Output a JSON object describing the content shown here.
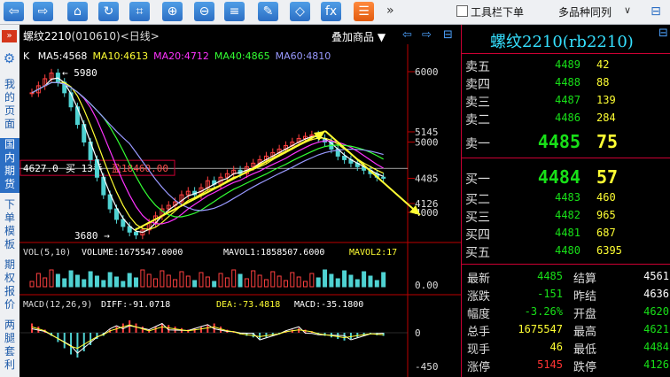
{
  "toolbar": {
    "buttons": [
      {
        "name": "back-button",
        "glyph": "⇦"
      },
      {
        "name": "forward-button",
        "glyph": "⇨"
      },
      {
        "name": "home-button",
        "glyph": "⌂"
      },
      {
        "name": "refresh-button",
        "glyph": "↻"
      },
      {
        "name": "crop-button",
        "glyph": "⌗"
      },
      {
        "name": "zoom-in-button",
        "glyph": "⊕"
      },
      {
        "name": "zoom-out-button",
        "glyph": "⊖"
      },
      {
        "name": "indicator-button",
        "glyph": "≡"
      },
      {
        "name": "draw-button",
        "glyph": "✎"
      },
      {
        "name": "mark-button",
        "glyph": "◇"
      },
      {
        "name": "fx-button",
        "glyph": "fx"
      },
      {
        "name": "list-button",
        "glyph": "☰"
      }
    ],
    "more_glyph": "»",
    "order_label": "工具栏下单",
    "select_value": "多品种同列",
    "select_arrow": "∨",
    "layout_glyph": "⊟"
  },
  "sidebar": {
    "collapse_glyph": "»",
    "gear_glyph": "⚙",
    "items": [
      {
        "label": "我的页面",
        "active": false
      },
      {
        "label": "国内期货",
        "active": true
      },
      {
        "label": "下单模板",
        "active": false
      },
      {
        "label": "期权报价",
        "active": false
      },
      {
        "label": "两腿套利",
        "active": false
      }
    ]
  },
  "chart_header": {
    "symbol": "螺纹2210",
    "code": "(010610)",
    "period": "<日线>",
    "overlay": "叠加商品",
    "overlay_arrow": "▼",
    "icon_prev": "⇦",
    "icon_next": "⇨",
    "icon_layout": "⊟"
  },
  "ma": {
    "k": "K",
    "items": [
      {
        "label": "MA5:4568",
        "color": "#ffffff"
      },
      {
        "label": "MA10:4613",
        "color": "#ffff33"
      },
      {
        "label": "MA20:4712",
        "color": "#ff33ff"
      },
      {
        "label": "MA40:4865",
        "color": "#33ff33"
      },
      {
        "label": "MA60:4810",
        "color": "#9999ff"
      }
    ]
  },
  "chart_data": [
    {
      "type": "candlestick",
      "panel": "price",
      "y_ticks": [
        6000,
        5145,
        5000,
        4485,
        4126,
        4000
      ],
      "annotations": {
        "high": "5980",
        "low": "3680",
        "crosshair_price": "4627.0",
        "position_label": "买 13手",
        "profit_label": "盈18460.00"
      },
      "ma_values": {
        "MA5": 4568,
        "MA10": 4613,
        "MA20": 4712,
        "MA40": 4865,
        "MA60": 4810
      }
    },
    {
      "type": "bar",
      "panel": "volume",
      "label": "VOL(5,10)",
      "volume": "VOLUME:1675547.0000",
      "mavol1": "MAVOL1:1858507.6000",
      "mavol2": "MAVOL2:17",
      "y_ticks": [
        "0.00"
      ]
    },
    {
      "type": "bar",
      "panel": "macd",
      "label": "MACD(12,26,9)",
      "diff": "DIFF:-91.0718",
      "dea": "DEA:-73.4818",
      "macd": "MACD:-35.1800",
      "y_ticks": [
        "0",
        "-450"
      ]
    }
  ],
  "quote": {
    "title": "螺纹2210(rb2210)",
    "title_icon": "⊟",
    "asks": [
      {
        "label": "卖五",
        "price": "4489",
        "vol": "42"
      },
      {
        "label": "卖四",
        "price": "4488",
        "vol": "88"
      },
      {
        "label": "卖三",
        "price": "4487",
        "vol": "139"
      },
      {
        "label": "卖二",
        "price": "4486",
        "vol": "284"
      },
      {
        "label": "卖一",
        "price": "4485",
        "vol": "75"
      }
    ],
    "bids": [
      {
        "label": "买一",
        "price": "4484",
        "vol": "57"
      },
      {
        "label": "买二",
        "price": "4483",
        "vol": "460"
      },
      {
        "label": "买三",
        "price": "4482",
        "vol": "965"
      },
      {
        "label": "买四",
        "price": "4481",
        "vol": "687"
      },
      {
        "label": "买五",
        "price": "4480",
        "vol": "6395"
      }
    ],
    "stats": [
      {
        "l1": "最新",
        "v1": "4485",
        "c1": "#18e018",
        "l2": "结算",
        "v2": "4561",
        "c2": "#ffffff"
      },
      {
        "l1": "涨跌",
        "v1": "-151",
        "c1": "#18e018",
        "l2": "昨结",
        "v2": "4636",
        "c2": "#ffffff"
      },
      {
        "l1": "幅度",
        "v1": "-3.26%",
        "c1": "#18e018",
        "l2": "开盘",
        "v2": "4620",
        "c2": "#18e018"
      },
      {
        "l1": "总手",
        "v1": "1675547",
        "c1": "#ffff33",
        "l2": "最高",
        "v2": "4621",
        "c2": "#18e018"
      },
      {
        "l1": "现手",
        "v1": "46",
        "c1": "#ffff33",
        "l2": "最低",
        "v2": "4484",
        "c2": "#18e018"
      },
      {
        "l1": "涨停",
        "v1": "5145",
        "c1": "#ff3333",
        "l2": "跌停",
        "v2": "4126",
        "c2": "#18e018"
      }
    ]
  }
}
